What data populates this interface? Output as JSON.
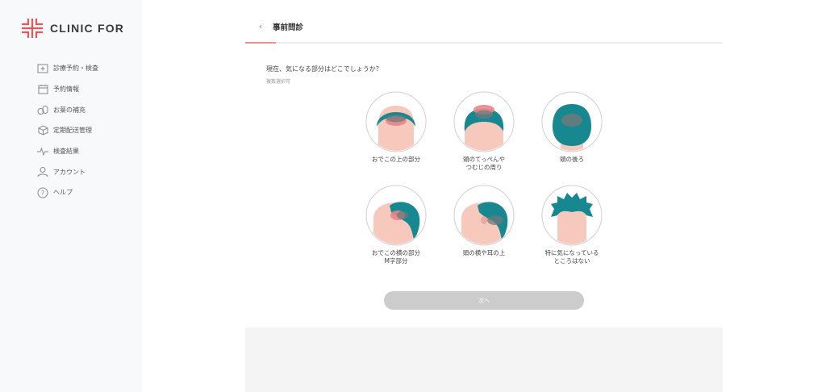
{
  "sidebar": {
    "logo_text": "CLINIC FOR",
    "items": [
      {
        "label": "診療予約・検査",
        "icon": "clinic-icon"
      },
      {
        "label": "予約情報",
        "icon": "calendar-icon"
      },
      {
        "label": "お薬の補充",
        "icon": "pills-icon"
      },
      {
        "label": "定期配送管理",
        "icon": "box-icon"
      },
      {
        "label": "検査結果",
        "icon": "pulse-icon"
      },
      {
        "label": "アカウント",
        "icon": "user-icon"
      },
      {
        "label": "ヘルプ",
        "icon": "help-icon"
      }
    ]
  },
  "header": {
    "title": "事前問診",
    "back_icon": "chevron-left-icon"
  },
  "progress": {
    "fraction": 0.065
  },
  "question": {
    "text": "現在、気になる部分はどこでしょうか？",
    "note": "複数選択可"
  },
  "options": [
    {
      "label": "おでこの上の部分"
    },
    {
      "label": "頭のてっぺんや\nつむじの周り"
    },
    {
      "label": "頭の後ろ"
    },
    {
      "label": "おでこの横の部分\nM字部分"
    },
    {
      "label": "頭の横や耳の上"
    },
    {
      "label": "特に気になっている\nところはない"
    }
  ],
  "next_button": {
    "label": "次へ"
  },
  "colors": {
    "accent": "#e05a5a",
    "hair": "#17888f",
    "skin": "#f7c9bd",
    "disabled": "#cccccc"
  }
}
